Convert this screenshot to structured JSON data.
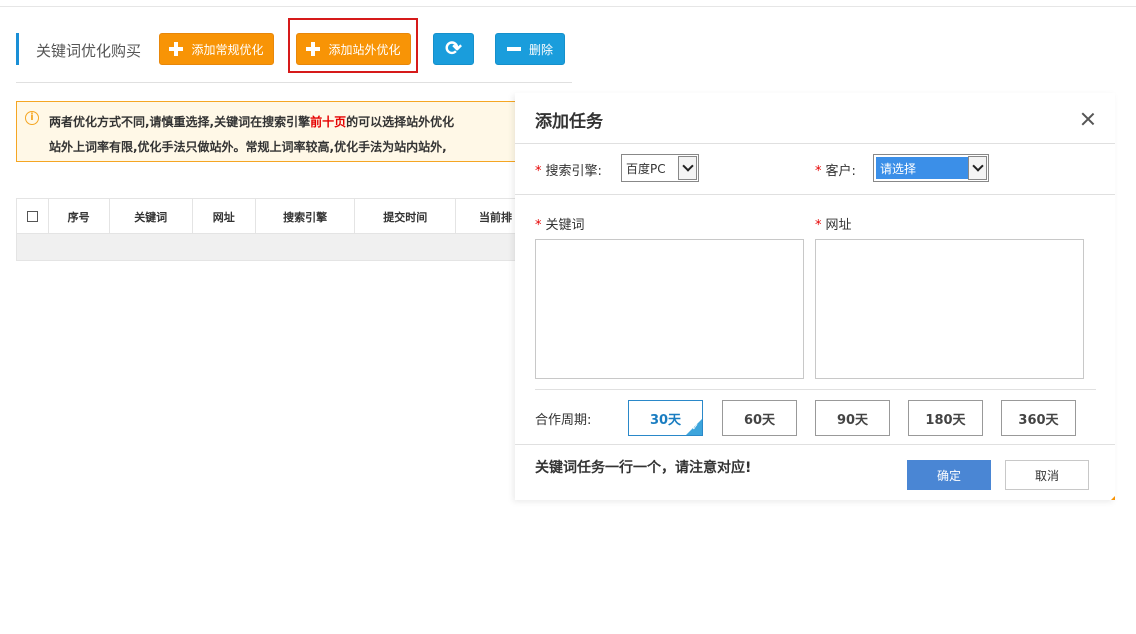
{
  "header": {
    "title": "关键词优化购买",
    "add_regular_label": "添加常规优化",
    "add_offsite_label": "添加站外优化",
    "delete_label": "删除",
    "refresh_icon": "refresh-icon",
    "accent_color": "#f89406",
    "blue_color": "#1a9ddc"
  },
  "notice": {
    "line1_prefix": "两者优化方式不同,请慎重选择,关键词在搜索引擎",
    "line1_highlight": "前十页",
    "line1_suffix": "的可以选择站外优化",
    "line2": "站外上词率有限,优化手法只做站外。常规上词率较高,优化手法为站内站外,"
  },
  "table": {
    "columns": [
      "序号",
      "关键词",
      "网址",
      "搜索引擎",
      "提交时间",
      "当前排"
    ]
  },
  "modal": {
    "title": "添加任务",
    "search_engine_label": "搜索引擎:",
    "search_engine_value": "百度PC",
    "customer_label": "客户:",
    "customer_value": "请选择",
    "keyword_label": "关键词",
    "url_label": "网址",
    "period_label": "合作周期:",
    "periods": [
      "30天",
      "60天",
      "90天",
      "180天",
      "360天"
    ],
    "selected_period": "30天",
    "footer_note": "关键词任务一行一个，请注意对应!",
    "confirm_label": "确定",
    "cancel_label": "取消"
  }
}
